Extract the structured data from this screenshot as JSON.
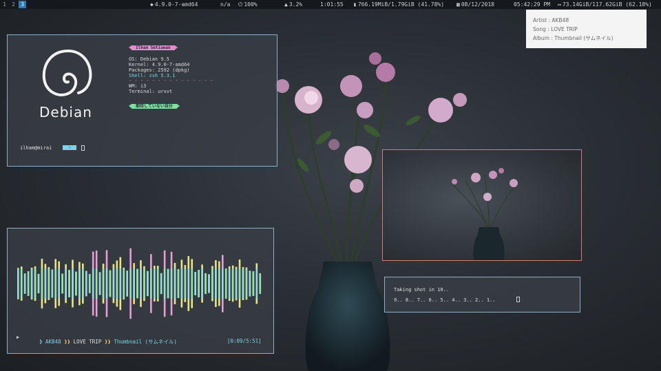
{
  "bar": {
    "workspaces": [
      "1",
      "2",
      "3"
    ],
    "active_workspace": "3",
    "kernel": "4.9.0-7-amd64",
    "net": "n/a",
    "battery": "100%",
    "cpu": "3.2%",
    "uptime": "1:01:55",
    "memory": "766.19MiB/1.79GiB (41.78%)",
    "date": "08/12/2018",
    "time": "05:42:29 PM",
    "disk": "73.14GiB/117.62GiB (62.18%)"
  },
  "notification": {
    "artist": "Artist : AKB48",
    "song": "Song   : LOVE TRIP",
    "album": "Album  : Thumbnail (サムネイル)"
  },
  "fetch": {
    "logo_text": "Debian",
    "user_tag": "Ilham Setiawan",
    "os": "OS: Debian 9.5",
    "kernel": "Kernel: 4.9.0-7-amd64",
    "packages": "Packages: 2592 (dpkg)",
    "shell": "Shell: zsh 5.3.1",
    "separator": "- - - - - - - - - - - - - - -",
    "wm": "WM: i3",
    "terminal": "Terminal: urxvt",
    "jp_tag": "期待していない自分",
    "prompt_user": "ilham@mirai",
    "prompt_arrow": "~"
  },
  "player": {
    "play_symbol": "▶",
    "sep1": "❱",
    "artist": "AKB48",
    "sep2": "❱❱",
    "song": "LOVE TRIP",
    "sep3": "❱❱",
    "album": "Thumbnail (サムネイル)",
    "position": "[0:09/5:51]"
  },
  "screenshot_terminal": {
    "line1": "Taking shot in 10..",
    "line2": "9.. 8.. 7.. 6.. 5.. 4.. 3.. 2.. 1.."
  },
  "colors": {
    "border": "#8faec8",
    "pink": "#e58bd0",
    "green": "#7ee0a0",
    "cyan": "#7fd3e8",
    "workspace_active": "#2e77b8"
  }
}
